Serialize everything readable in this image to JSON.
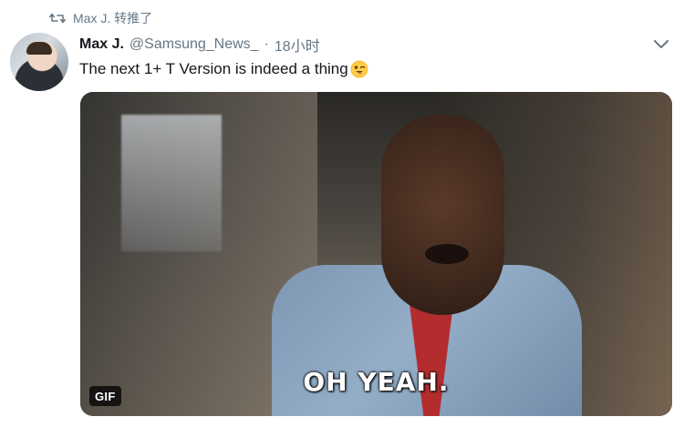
{
  "retweet": {
    "text": "Max J. 转推了",
    "icon": "retweet-icon"
  },
  "tweet": {
    "display_name": "Max J.",
    "handle": "@Samsung_News_",
    "separator": "·",
    "timestamp": "18小时",
    "text": "The next 1+ T Version is indeed a thing",
    "emoji_icon": "winking-face-with-tongue-icon"
  },
  "media": {
    "badge": "GIF",
    "caption": "OH YEAH."
  },
  "colors": {
    "muted_text": "#657786",
    "primary_text": "#14171a"
  }
}
